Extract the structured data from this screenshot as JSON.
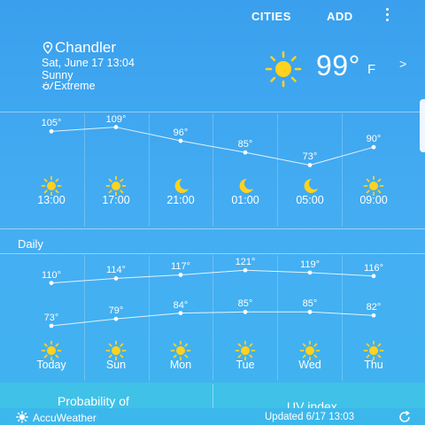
{
  "header": {
    "cities_label": "CITIES",
    "add_label": "ADD"
  },
  "current": {
    "city": "Chandler",
    "datetime": "Sat, June 17 13:04",
    "condition": "Sunny",
    "uv": "Extreme",
    "temp": "99°",
    "unit": "F",
    "chevron": ">"
  },
  "hourly": [
    {
      "time": "13:00",
      "temp": "105°",
      "icon": "sun-icon"
    },
    {
      "time": "17:00",
      "temp": "109°",
      "icon": "sun-icon"
    },
    {
      "time": "21:00",
      "temp": "96°",
      "icon": "moon-icon"
    },
    {
      "time": "01:00",
      "temp": "85°",
      "icon": "moon-icon"
    },
    {
      "time": "05:00",
      "temp": "73°",
      "icon": "moon-icon"
    },
    {
      "time": "09:00",
      "temp": "90°",
      "icon": "sun-icon"
    }
  ],
  "daily_label": "Daily",
  "daily": [
    {
      "day": "Today",
      "high": "110°",
      "low": "73°",
      "icon": "sun-icon"
    },
    {
      "day": "Sun",
      "high": "114°",
      "low": "79°",
      "icon": "sun-icon"
    },
    {
      "day": "Mon",
      "high": "117°",
      "low": "84°",
      "icon": "sun-icon"
    },
    {
      "day": "Tue",
      "high": "121°",
      "low": "85°",
      "icon": "sun-icon"
    },
    {
      "day": "Wed",
      "high": "119°",
      "low": "85°",
      "icon": "sun-icon"
    },
    {
      "day": "Thu",
      "high": "116°",
      "low": "82°",
      "icon": "sun-icon"
    }
  ],
  "cards": {
    "probability": "Probability of",
    "uv_index": "UV index"
  },
  "footer": {
    "brand": "AccuWeather",
    "updated": "Updated 6/17  13:03"
  },
  "colors": {
    "background": "#3fa3ee",
    "sun": "#ffd21e",
    "moon": "#ffd21e"
  }
}
